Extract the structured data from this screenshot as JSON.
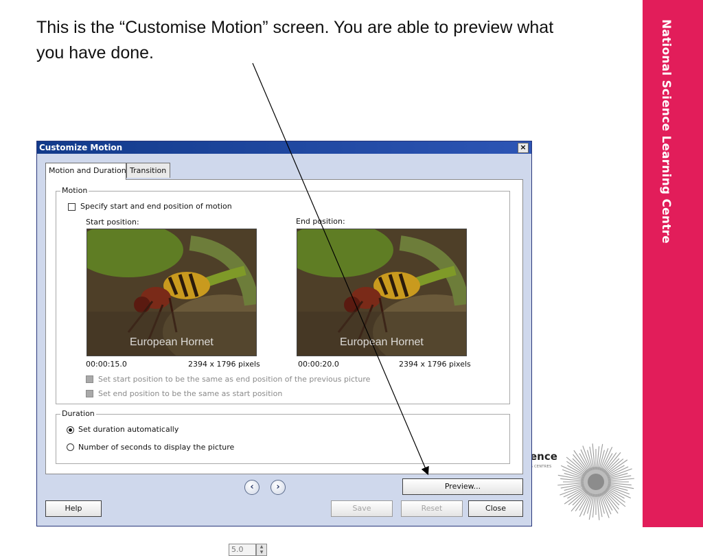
{
  "slide": {
    "caption": "This is the “Customise Motion” screen.  You are able to preview what you have done.",
    "side_band_text": "National Science Learning Centre",
    "side_band_color": "#e21d5a",
    "logo_text": "ence",
    "logo_subtext": "G CENTRES"
  },
  "dialog": {
    "title": "Customize Motion",
    "close_glyph": "×",
    "tabs": [
      {
        "label": "Motion and Duration",
        "active": true
      },
      {
        "label": "Transition",
        "active": false
      }
    ],
    "motion": {
      "legend": "Motion",
      "specify_label": "Specify start and end position of motion",
      "specify_checked": false,
      "start_label": "Start position:",
      "end_label": "End position:",
      "start_image_caption": "European Hornet",
      "end_image_caption": "European Hornet",
      "start_time": "00:00:15.0",
      "start_size": "2394 x 1796 pixels",
      "end_time": "00:00:20.0",
      "end_size": "2394 x 1796 pixels",
      "same_as_prev_label": "Set start position to be the same as end position of the previous picture",
      "same_as_start_label": "Set end position to be the same as start position"
    },
    "duration": {
      "legend": "Duration",
      "auto_label": "Set duration automatically",
      "auto_selected": true,
      "seconds_label": "Number of seconds to display the picture",
      "seconds_value": "5.0"
    },
    "buttons": {
      "preview": "Preview...",
      "help": "Help",
      "save": "Save",
      "reset": "Reset",
      "close": "Close"
    },
    "nav": {
      "prev_glyph": "‹",
      "next_glyph": "›"
    },
    "colors": {
      "titlebar": "#123a8a",
      "dialog_bg": "#cfd8ec"
    }
  }
}
